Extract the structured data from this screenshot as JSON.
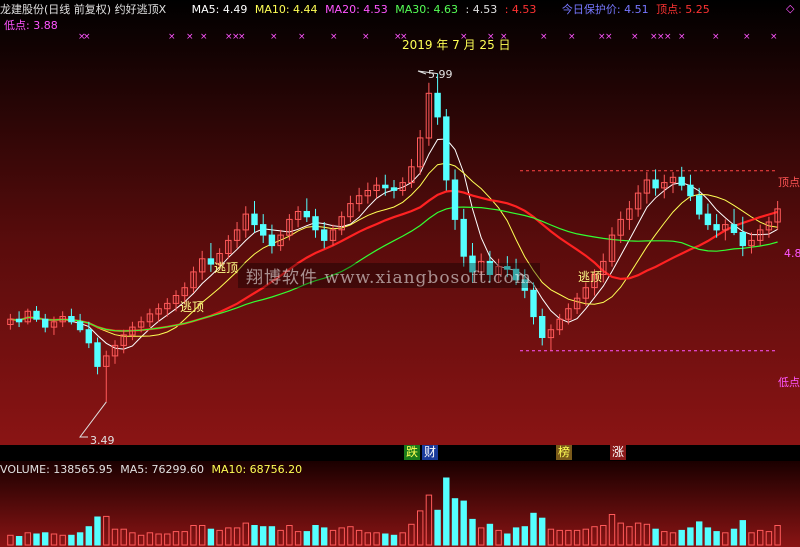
{
  "header": {
    "stock_title": "龙建股份(日线 前复权) 约好逃顶X",
    "ma5": "MA5: 4.49",
    "ma10": "MA10: 4.44",
    "ma20": "MA20: 4.53",
    "ma30": "MA30: 4.63",
    "extra1": ": 4.53",
    "extra2": ": 4.53",
    "protect": "今日保护价: 4.51",
    "top": "顶点: 5.25",
    "corner": "◇",
    "low": "低点: 3.88"
  },
  "date_label": "2019 年 7 月 25 日",
  "watermark": "翔博软件 www.xiangbosoft.com",
  "annotations": {
    "peak": "5.99",
    "trough": "3.49",
    "escape1": "逃顶",
    "escape2": "逃顶",
    "escape3": "逃顶",
    "right_top": "顶点",
    "right_low": "低点",
    "right_price": "4.8",
    "tag_die": "跌",
    "tag_cai": "财",
    "tag_bang": "榜",
    "tag_zhang": "涨"
  },
  "volume": {
    "label": "VOLUME: 138565.95",
    "ma5": "MA5: 76299.60",
    "ma10": "MA10: 68756.20"
  },
  "colors": {
    "up": "#ff5a5a",
    "down": "#55ffff",
    "ma5": "#ffffff",
    "ma10": "#ffff55",
    "ma20": "#ff33ff",
    "ma30": "#33ff33",
    "header_blue": "#6666ff",
    "header_red": "#ff3333",
    "magenta": "#ff55ff"
  },
  "chart_data": {
    "type": "candlestick",
    "ylim": [
      3.2,
      6.2
    ],
    "candles": [
      [
        4.08,
        4.16,
        4.04,
        4.12
      ],
      [
        4.12,
        4.18,
        4.06,
        4.1
      ],
      [
        4.1,
        4.2,
        4.08,
        4.18
      ],
      [
        4.18,
        4.22,
        4.1,
        4.12
      ],
      [
        4.12,
        4.16,
        4.02,
        4.06
      ],
      [
        4.06,
        4.14,
        4.0,
        4.1
      ],
      [
        4.1,
        4.18,
        4.06,
        4.14
      ],
      [
        4.14,
        4.2,
        4.08,
        4.1
      ],
      [
        4.1,
        4.16,
        4.02,
        4.04
      ],
      [
        4.04,
        4.1,
        3.9,
        3.94
      ],
      [
        3.94,
        3.98,
        3.7,
        3.76
      ],
      [
        3.76,
        3.88,
        3.49,
        3.84
      ],
      [
        3.84,
        3.96,
        3.78,
        3.92
      ],
      [
        3.92,
        4.04,
        3.86,
        4.0
      ],
      [
        4.0,
        4.1,
        3.96,
        4.06
      ],
      [
        4.06,
        4.14,
        4.02,
        4.1
      ],
      [
        4.1,
        4.2,
        4.06,
        4.16
      ],
      [
        4.16,
        4.24,
        4.1,
        4.2
      ],
      [
        4.2,
        4.28,
        4.14,
        4.24
      ],
      [
        4.24,
        4.34,
        4.18,
        4.3
      ],
      [
        4.3,
        4.4,
        4.24,
        4.36
      ],
      [
        4.36,
        4.52,
        4.32,
        4.48
      ],
      [
        4.48,
        4.64,
        4.42,
        4.58
      ],
      [
        4.58,
        4.7,
        4.48,
        4.54
      ],
      [
        4.54,
        4.66,
        4.5,
        4.62
      ],
      [
        4.62,
        4.76,
        4.58,
        4.72
      ],
      [
        4.72,
        4.86,
        4.66,
        4.8
      ],
      [
        4.8,
        4.98,
        4.74,
        4.92
      ],
      [
        4.92,
        5.02,
        4.78,
        4.84
      ],
      [
        4.84,
        4.92,
        4.7,
        4.76
      ],
      [
        4.76,
        4.84,
        4.62,
        4.68
      ],
      [
        4.68,
        4.8,
        4.64,
        4.76
      ],
      [
        4.76,
        4.92,
        4.72,
        4.88
      ],
      [
        4.88,
        4.98,
        4.82,
        4.94
      ],
      [
        4.94,
        5.04,
        4.86,
        4.9
      ],
      [
        4.9,
        4.96,
        4.74,
        4.8
      ],
      [
        4.8,
        4.86,
        4.66,
        4.72
      ],
      [
        4.72,
        4.84,
        4.68,
        4.8
      ],
      [
        4.8,
        4.94,
        4.76,
        4.9
      ],
      [
        4.9,
        5.06,
        4.86,
        5.0
      ],
      [
        5.0,
        5.12,
        4.94,
        5.06
      ],
      [
        5.06,
        5.16,
        5.0,
        5.1
      ],
      [
        5.1,
        5.2,
        5.04,
        5.14
      ],
      [
        5.14,
        5.22,
        5.06,
        5.12
      ],
      [
        5.12,
        5.18,
        5.04,
        5.1
      ],
      [
        5.1,
        5.2,
        5.06,
        5.16
      ],
      [
        5.16,
        5.34,
        5.12,
        5.28
      ],
      [
        5.28,
        5.56,
        5.22,
        5.5
      ],
      [
        5.5,
        5.92,
        5.44,
        5.84
      ],
      [
        5.84,
        5.99,
        5.6,
        5.66
      ],
      [
        5.66,
        5.72,
        5.1,
        5.18
      ],
      [
        5.18,
        5.26,
        4.8,
        4.88
      ],
      [
        4.88,
        4.96,
        4.52,
        4.6
      ],
      [
        4.6,
        4.7,
        4.4,
        4.48
      ],
      [
        4.48,
        4.62,
        4.42,
        4.56
      ],
      [
        4.56,
        4.64,
        4.4,
        4.46
      ],
      [
        4.46,
        4.58,
        4.4,
        4.52
      ],
      [
        4.52,
        4.6,
        4.44,
        4.5
      ],
      [
        4.5,
        4.58,
        4.38,
        4.42
      ],
      [
        4.42,
        4.5,
        4.28,
        4.34
      ],
      [
        4.34,
        4.4,
        4.08,
        4.14
      ],
      [
        4.14,
        4.2,
        3.92,
        3.98
      ],
      [
        3.98,
        4.08,
        3.88,
        4.04
      ],
      [
        4.04,
        4.16,
        4.0,
        4.12
      ],
      [
        4.12,
        4.24,
        4.08,
        4.2
      ],
      [
        4.2,
        4.32,
        4.16,
        4.28
      ],
      [
        4.28,
        4.4,
        4.22,
        4.36
      ],
      [
        4.36,
        4.5,
        4.3,
        4.46
      ],
      [
        4.46,
        4.62,
        4.4,
        4.56
      ],
      [
        4.56,
        4.82,
        4.52,
        4.76
      ],
      [
        4.76,
        4.94,
        4.7,
        4.88
      ],
      [
        4.88,
        5.02,
        4.8,
        4.96
      ],
      [
        4.96,
        5.14,
        4.9,
        5.08
      ],
      [
        5.08,
        5.24,
        5.0,
        5.18
      ],
      [
        5.18,
        5.26,
        5.06,
        5.12
      ],
      [
        5.12,
        5.22,
        5.04,
        5.16
      ],
      [
        5.16,
        5.24,
        5.08,
        5.2
      ],
      [
        5.2,
        5.28,
        5.1,
        5.14
      ],
      [
        5.14,
        5.22,
        5.02,
        5.06
      ],
      [
        5.06,
        5.12,
        4.88,
        4.92
      ],
      [
        4.92,
        5.0,
        4.8,
        4.84
      ],
      [
        4.84,
        4.92,
        4.74,
        4.8
      ],
      [
        4.8,
        4.88,
        4.72,
        4.84
      ],
      [
        4.84,
        4.96,
        4.76,
        4.78
      ],
      [
        4.78,
        4.9,
        4.6,
        4.68
      ],
      [
        4.68,
        4.78,
        4.62,
        4.72
      ],
      [
        4.72,
        4.84,
        4.68,
        4.8
      ],
      [
        4.8,
        4.9,
        4.74,
        4.86
      ],
      [
        4.86,
        5.02,
        4.8,
        4.96
      ]
    ]
  }
}
